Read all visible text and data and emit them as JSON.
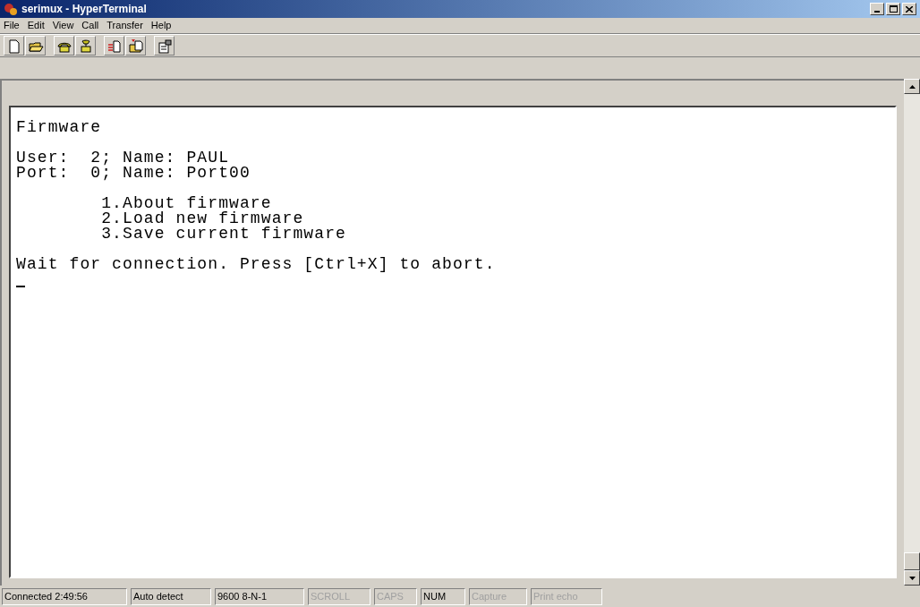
{
  "window": {
    "title": "serimux - HyperTerminal"
  },
  "menu": [
    "File",
    "Edit",
    "View",
    "Call",
    "Transfer",
    "Help"
  ],
  "toolbar": [
    {
      "kind": "new"
    },
    {
      "kind": "open"
    },
    {
      "kind": "call"
    },
    {
      "kind": "hangup"
    },
    {
      "kind": "send"
    },
    {
      "kind": "receive"
    },
    {
      "kind": "properties"
    }
  ],
  "terminal": {
    "blocks": [
      [
        "Firmware"
      ],
      [
        "User:  2; Name: PAUL",
        "Port:  0; Name: Port00"
      ],
      [
        "        1.About firmware",
        "        2.Load new firmware",
        "        3.Save current firmware"
      ],
      [
        "Wait for connection. Press [Ctrl+X] to abort."
      ]
    ]
  },
  "status_bar": [
    {
      "text": "Connected 2:49:56",
      "disabled": false
    },
    {
      "text": "Auto detect",
      "disabled": false
    },
    {
      "text": "9600 8-N-1",
      "disabled": false
    },
    {
      "text": "SCROLL",
      "disabled": true
    },
    {
      "text": "CAPS",
      "disabled": true
    },
    {
      "text": "NUM",
      "disabled": false
    },
    {
      "text": "Capture",
      "disabled": true
    },
    {
      "text": "Print echo",
      "disabled": true
    }
  ]
}
